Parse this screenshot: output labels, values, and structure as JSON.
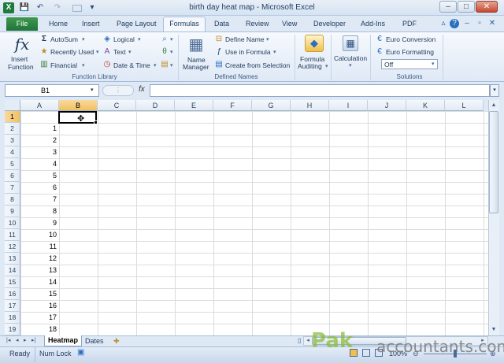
{
  "window": {
    "title": "birth day heat map - Microsoft Excel",
    "minimize": "–",
    "maximize": "□",
    "close": "✕"
  },
  "quick_access": {
    "logo": "X",
    "save": "💾",
    "undo": "↶",
    "redo": "↷",
    "customize": "▾"
  },
  "tabs": [
    "File",
    "Home",
    "Insert",
    "Page Layout",
    "Formulas",
    "Data",
    "Review",
    "View",
    "Developer",
    "Add-Ins",
    "PDF"
  ],
  "ribbon": {
    "function_library": {
      "insert_function": "Insert Function",
      "insert_function_line1": "Insert",
      "insert_function_line2": "Function",
      "fx": "fx",
      "autosum": "AutoSum",
      "recently_used": "Recently Used",
      "financial": "Financial",
      "logical": "Logical",
      "text": "Text",
      "date_time": "Date & Time",
      "group_label": "Function Library"
    },
    "defined_names": {
      "name_manager_line1": "Name",
      "name_manager_line2": "Manager",
      "define_name": "Define Name",
      "use_in_formula": "Use in Formula",
      "create_from_selection": "Create from Selection",
      "group_label": "Defined Names"
    },
    "auditing": {
      "line1": "Formula",
      "line2": "Auditing"
    },
    "calculation": {
      "label": "Calculation"
    },
    "solutions": {
      "euro_conversion": "Euro Conversion",
      "euro_formatting": "Euro Formatting",
      "off_select": "Off",
      "group_label": "Solutions"
    }
  },
  "formula_bar": {
    "name_box": "B1",
    "fx": "fx",
    "value": ""
  },
  "grid": {
    "columns": [
      "A",
      "B",
      "C",
      "D",
      "E",
      "F",
      "G",
      "H",
      "I",
      "J",
      "K",
      "L"
    ],
    "selected_column": "B",
    "rows": [
      "1",
      "2",
      "3",
      "4",
      "5",
      "6",
      "7",
      "8",
      "9",
      "10",
      "11",
      "12",
      "13",
      "14",
      "15",
      "16",
      "17",
      "18",
      "19"
    ],
    "selected_row": "1",
    "col_a_values": [
      "",
      "1",
      "2",
      "3",
      "4",
      "5",
      "6",
      "7",
      "8",
      "9",
      "10",
      "11",
      "12",
      "13",
      "14",
      "15",
      "16",
      "17",
      "18"
    ]
  },
  "sheets": {
    "active": "Heatmap",
    "other": "Dates",
    "nav": [
      "|◂",
      "◂",
      "▸",
      "▸|"
    ]
  },
  "status": {
    "ready": "Ready",
    "num_lock": "Num Lock",
    "zoom": "100%"
  },
  "watermark": {
    "brand": "Pak",
    "rest": "accountants.com"
  }
}
